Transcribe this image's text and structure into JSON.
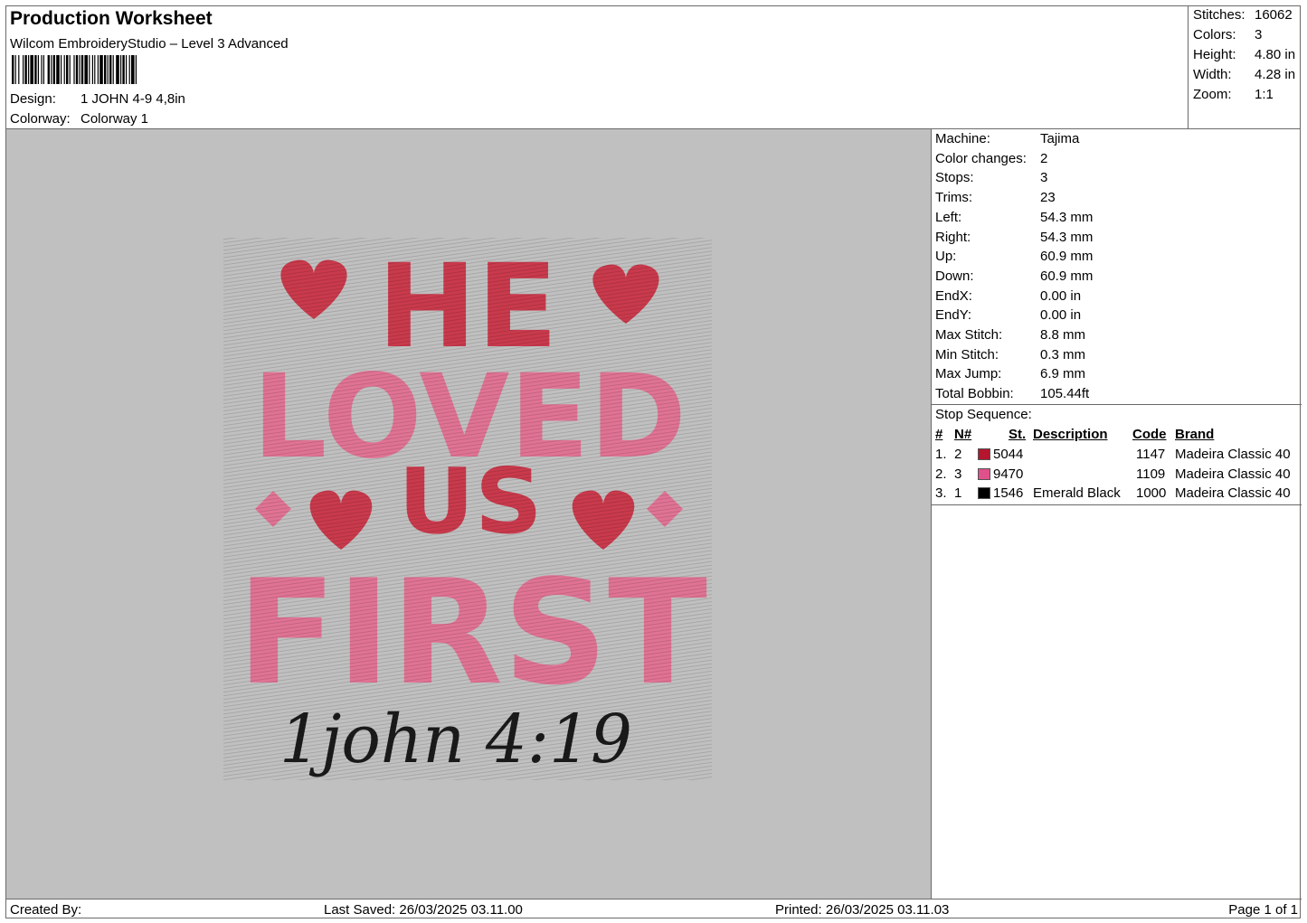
{
  "header": {
    "title": "Production Worksheet",
    "software": "Wilcom EmbroideryStudio – Level 3 Advanced",
    "design_label": "Design:",
    "design_value": "1 JOHN 4-9 4,8in",
    "colorway_label": "Colorway:",
    "colorway_value": "Colorway 1"
  },
  "stats": {
    "stitches_label": "Stitches:",
    "stitches": "16062",
    "colors_label": "Colors:",
    "colors": "3",
    "height_label": "Height:",
    "height": "4.80 in",
    "width_label": "Width:",
    "width": "4.28 in",
    "zoom_label": "Zoom:",
    "zoom": "1:1"
  },
  "design": {
    "line1": "HE",
    "line2": "LOVED",
    "line3": "US",
    "line4": "FIRST",
    "script": "1john 4:19",
    "colors": {
      "red": "#c93a4c",
      "pink": "#e07394",
      "black": "#1a1a1a",
      "background": "#c0c0c0"
    }
  },
  "properties": [
    {
      "label": "Machine:",
      "value": "Tajima"
    },
    {
      "label": "Color changes:",
      "value": "2"
    },
    {
      "label": "Stops:",
      "value": "3"
    },
    {
      "label": "Trims:",
      "value": "23"
    },
    {
      "label": "Left:",
      "value": "54.3 mm"
    },
    {
      "label": "Right:",
      "value": "54.3 mm"
    },
    {
      "label": "Up:",
      "value": "60.9 mm"
    },
    {
      "label": "Down:",
      "value": "60.9 mm"
    },
    {
      "label": "EndX:",
      "value": "0.00 in"
    },
    {
      "label": "EndY:",
      "value": "0.00 in"
    },
    {
      "label": "Max Stitch:",
      "value": "8.8 mm"
    },
    {
      "label": "Min Stitch:",
      "value": "0.3 mm"
    },
    {
      "label": "Max Jump:",
      "value": "6.9 mm"
    },
    {
      "label": "Total Bobbin:",
      "value": "105.44ft"
    }
  ],
  "stop_sequence": {
    "title": "Stop Sequence:",
    "headers": {
      "idx": "#",
      "num": "N#",
      "st": "St.",
      "desc": "Description",
      "code": "Code",
      "brand": "Brand"
    },
    "rows": [
      {
        "idx": "1.",
        "num": "2",
        "color": "#b5162e",
        "st": "5044",
        "desc": "",
        "code": "1147",
        "brand": "Madeira Classic 40"
      },
      {
        "idx": "2.",
        "num": "3",
        "color": "#e0508a",
        "st": "9470",
        "desc": "",
        "code": "1109",
        "brand": "Madeira Classic 40"
      },
      {
        "idx": "3.",
        "num": "1",
        "color": "#000000",
        "st": "1546",
        "desc": "Emerald Black",
        "code": "1000",
        "brand": "Madeira Classic 40"
      }
    ]
  },
  "footer": {
    "created_by": "Created By:",
    "last_saved": "Last Saved: 26/03/2025 03.11.00",
    "printed": "Printed: 26/03/2025 03.11.03",
    "page": "Page 1 of 1"
  }
}
